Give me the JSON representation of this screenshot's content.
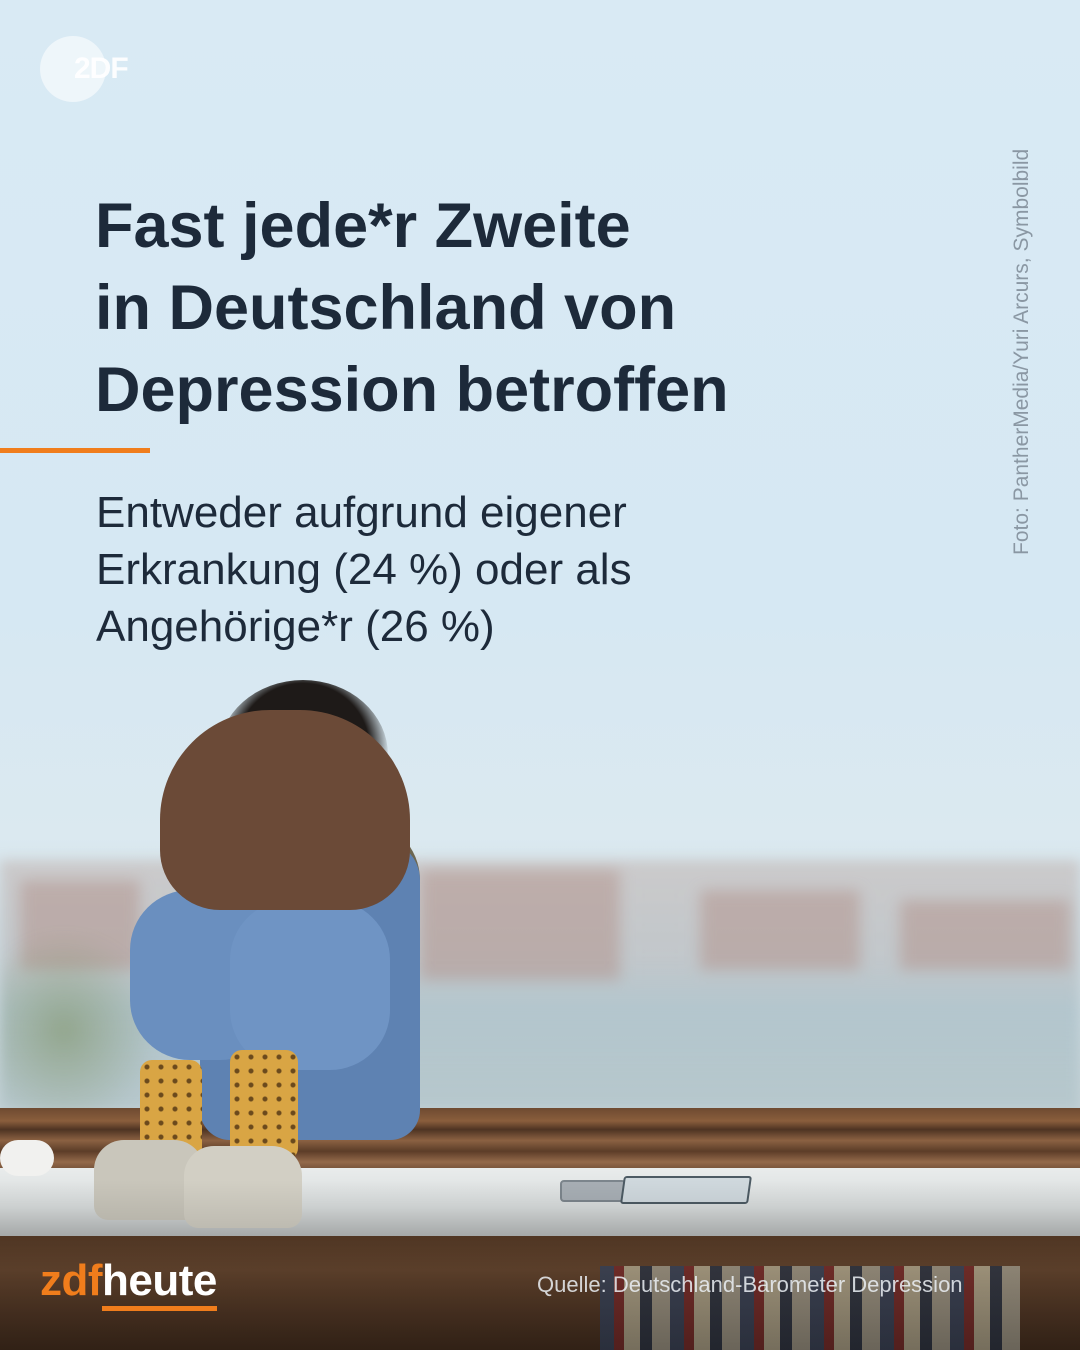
{
  "logo": {
    "badge_text": "2DF"
  },
  "headline": {
    "lines": [
      "Fast jede*r Zweite",
      "in Deutschland von",
      "Depression betroffen"
    ]
  },
  "subline": {
    "lines": [
      "Entweder aufgrund eigener",
      "Erkrankung (24 %) oder als",
      "Angehörige*r (26 %)"
    ]
  },
  "credit": "Foto: PantherMedia/Yuri Arcurs, Symbolbild",
  "brand": {
    "part1": "zdf",
    "part2": "heute"
  },
  "source": "Quelle: Deutschland-Barometer Depression",
  "colors": {
    "accent": "#f07d1c",
    "text_dark": "#1d2a3a"
  }
}
